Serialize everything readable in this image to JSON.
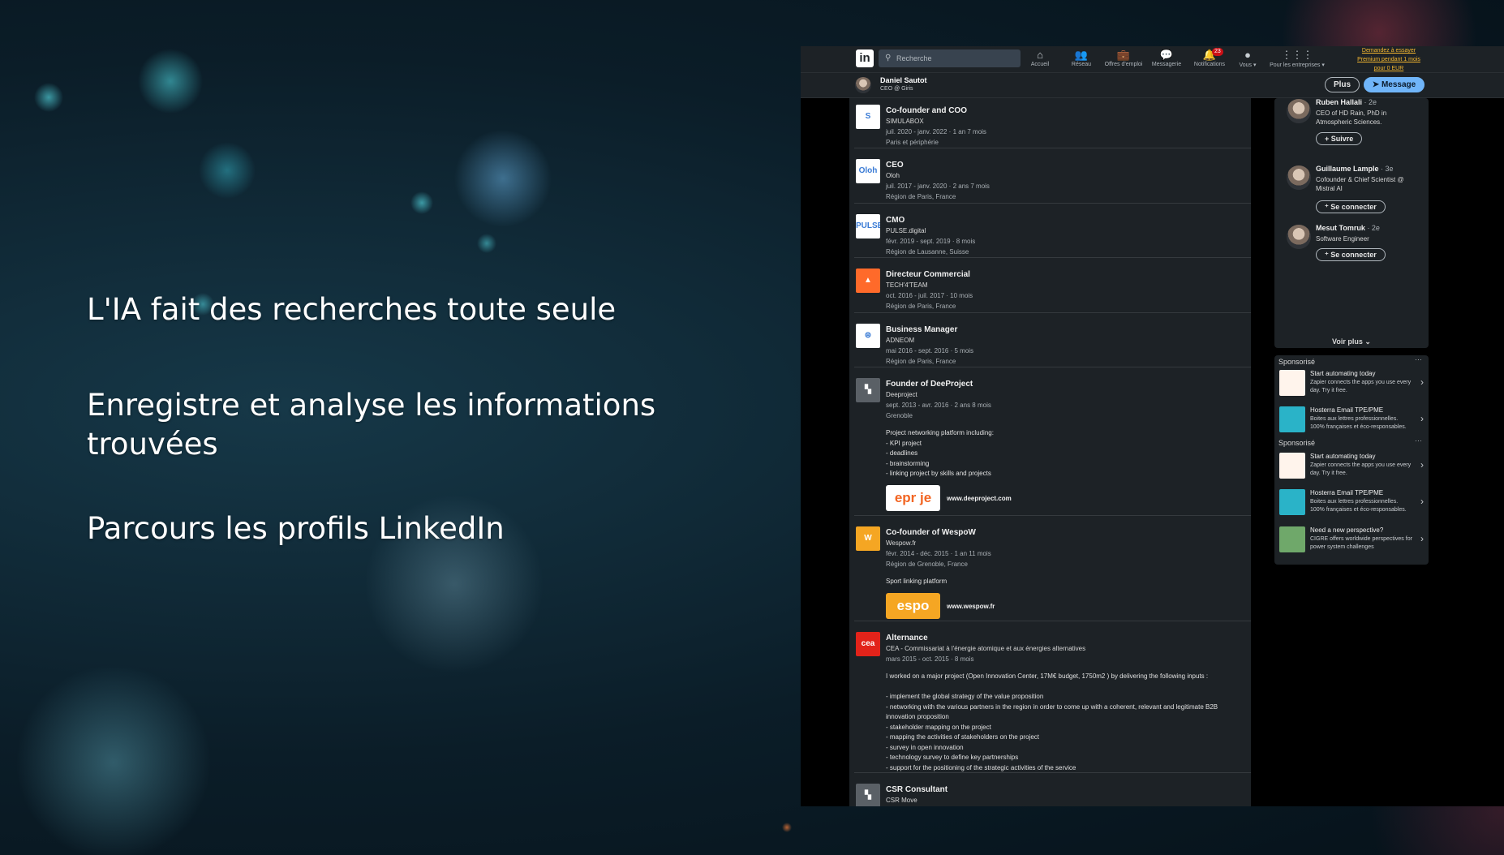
{
  "overlay": {
    "line1": "L'IA fait des recherches toute seule",
    "line2": "Enregistre et analyse les informations trouvées",
    "line3": "Parcours les profils LinkedIn"
  },
  "linkedin": {
    "logo_text": "in",
    "search_placeholder": "Recherche",
    "nav": [
      {
        "label": "Accueil",
        "icon": "home-icon",
        "glyph": "⌂"
      },
      {
        "label": "Réseau",
        "icon": "network-icon",
        "glyph": "👥"
      },
      {
        "label": "Offres d'emploi",
        "icon": "briefcase-icon",
        "glyph": "💼"
      },
      {
        "label": "Messagerie",
        "icon": "messaging-icon",
        "glyph": "💬"
      },
      {
        "label": "Notifications",
        "icon": "bell-icon",
        "glyph": "🔔",
        "badge": "23"
      },
      {
        "label": "Vous ▾",
        "icon": "avatar-icon",
        "glyph": "●"
      },
      {
        "label": "Pour les entreprises ▾",
        "icon": "grid-icon",
        "glyph": "⋮⋮⋮"
      }
    ],
    "premium_cta": "Demandez à essayer Premium pendant 1 mois pour 0 EUR",
    "profile": {
      "name": "Daniel Sautot",
      "role": "CEO @ Giris",
      "btn_more": "Plus",
      "btn_message": "Message"
    },
    "experiences": [
      {
        "title": "Co-founder and COO",
        "company": "SIMULABOX",
        "dates": "juil. 2020 - janv. 2022 · 1 an 7 mois",
        "location": "Paris et périphérie",
        "logo_color": "#ffffff",
        "logo_text": "S"
      },
      {
        "title": "CEO",
        "company": "Oloh",
        "dates": "juil. 2017 - janv. 2020 · 2 ans 7 mois",
        "location": "Région de Paris, France",
        "logo_color": "#ffffff",
        "logo_text": "Oloh"
      },
      {
        "title": "CMO",
        "company": "PULSE.digital",
        "dates": "févr. 2019 - sept. 2019 · 8 mois",
        "location": "Région de Lausanne, Suisse",
        "logo_color": "#ffffff",
        "logo_text": "PULSE"
      },
      {
        "title": "Directeur Commercial",
        "company": "TECH'4'TEAM",
        "dates": "oct. 2016 - juil. 2017 · 10 mois",
        "location": "Région de Paris, France",
        "logo_color": "#ff6a2a",
        "logo_text": "▲"
      },
      {
        "title": "Business Manager",
        "company": "ADNEOM",
        "dates": "mai 2016 - sept. 2016 · 5 mois",
        "location": "Région de Paris, France",
        "logo_color": "#ffffff",
        "logo_text": "⊜"
      },
      {
        "title": "Founder of DeeProject",
        "company": "Deeproject",
        "dates": "sept. 2013 - avr. 2016 · 2 ans 8 mois",
        "location": "Grenoble",
        "logo_color": "#5a6066",
        "logo_text": "▚",
        "description": [
          "Project networking platform including:",
          "- KPI project",
          "- deadlines",
          "- brainstorming",
          "- linking project by skills and projects"
        ],
        "media_link": "www.deeproject.com",
        "media_text": "epr  je"
      },
      {
        "title": "Co-founder of WespoW",
        "company": "Wespow.fr",
        "dates": "févr. 2014 - déc. 2015 · 1 an 11 mois",
        "location": "Région de Grenoble, France",
        "logo_color": "#f5a623",
        "logo_text": "W",
        "description": [
          "Sport linking platform"
        ],
        "media_link": "www.wespow.fr",
        "media_text": "espo"
      },
      {
        "title": "Alternance",
        "company": "CEA - Commissariat à l'énergie atomique et aux énergies alternatives",
        "dates": "mars 2015 - oct. 2015 · 8 mois",
        "logo_color": "#e2231a",
        "logo_text": "cea",
        "description": [
          "I worked on a major project (Open Innovation Center, 17M€ budget, 1750m2 ) by delivering the following inputs :",
          "- implement the global strategy of the value proposition",
          "- networking with the various partners in the region in order to come up with a coherent, relevant and legitimate B2B innovation proposition",
          "- stakeholder mapping on the project",
          "- mapping the activities of stakeholders on the project",
          "- survey in open innovation",
          "- technology survey to define key partnerships",
          "- support for the positioning of the strategic activities of the service"
        ]
      },
      {
        "title": "CSR Consultant",
        "company": "CSR Move",
        "logo_color": "#5a6066",
        "logo_text": "▚"
      }
    ],
    "people": [
      {
        "name": "Ruben Hallali",
        "degree": "· 2e",
        "title": "CEO of HD Rain, PhD in Atmospheric Sciences.",
        "action": "+ Suivre"
      },
      {
        "name": "Guillaume Lample",
        "degree": "· 3e",
        "title": "Cofounder & Chief Scientist @ Mistral AI",
        "action": "⁺ Se connecter"
      },
      {
        "name": "Mesut Tomruk",
        "degree": "· 2e",
        "title": "Software Engineer",
        "action": "⁺ Se connecter"
      }
    ],
    "voir_plus": "Voir plus ⌄",
    "sponsored_label": "Sponsorisé",
    "ads": [
      {
        "title": "Start automating today",
        "text": "Zapier connects the apps you use every day. Try it free.",
        "icon": "zapier-icon"
      },
      {
        "title": "Hosterra Email TPE/PME",
        "text": "Boites aux lettres professionnelles. 100% françaises et éco-responsables.",
        "icon": "dino-icon"
      },
      {
        "title": "Start automating today",
        "text": "Zapier connects the apps you use every day. Try it free.",
        "icon": "zapier-icon"
      },
      {
        "title": "Hosterra Email TPE/PME",
        "text": "Boites aux lettres professionnelles. 100% françaises et éco-responsables.",
        "icon": "dino-icon"
      },
      {
        "title": "Need a new perspective?",
        "text": "CIGRE offers worldwide perspectives for power system challenges",
        "icon": "cigre-icon"
      }
    ]
  }
}
